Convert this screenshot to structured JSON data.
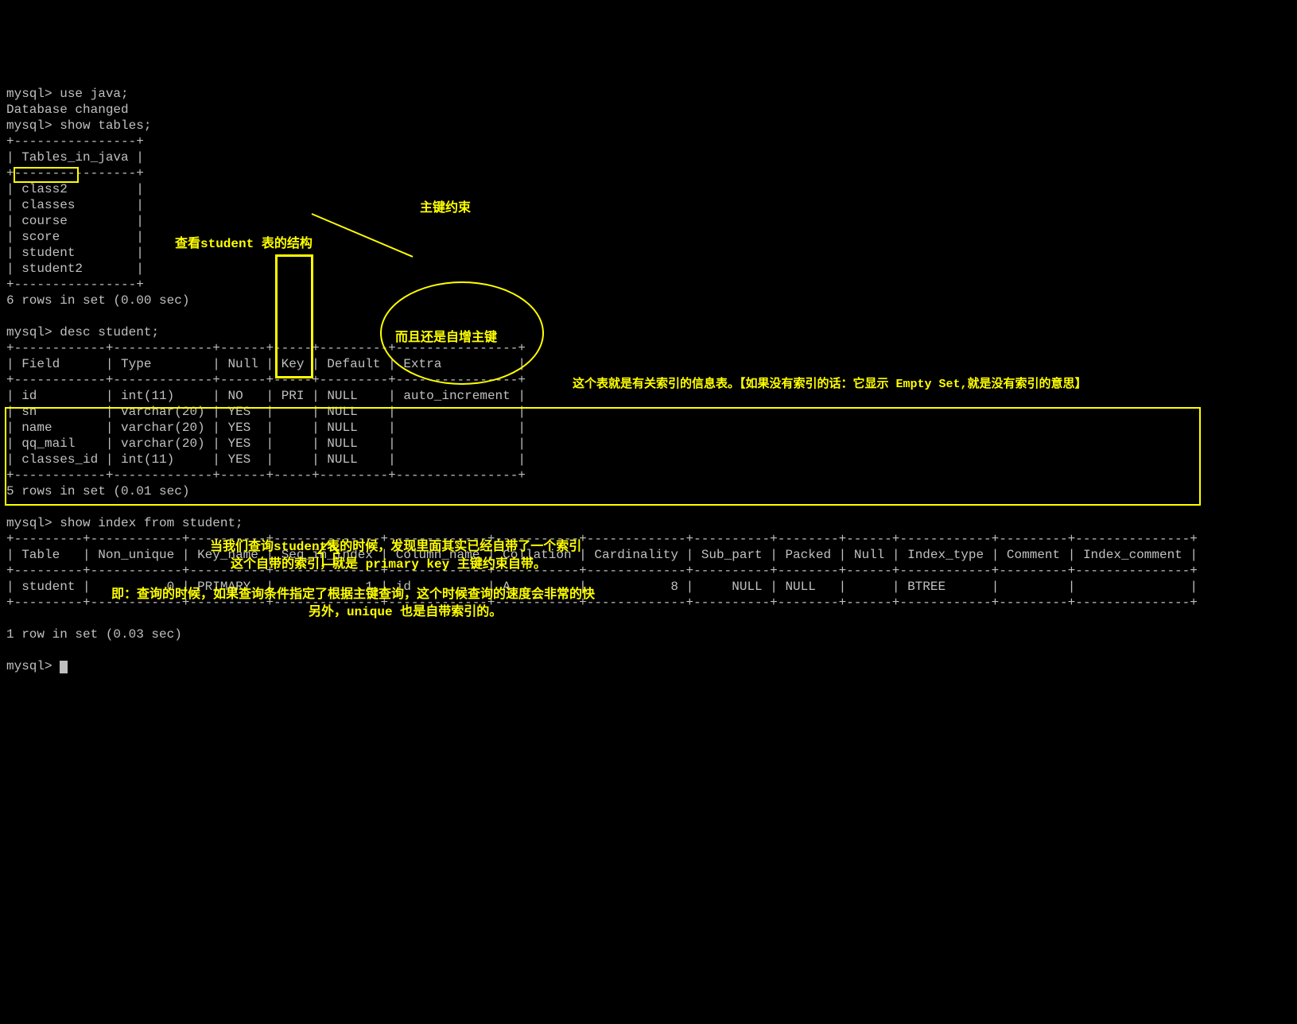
{
  "prompt": "mysql>",
  "cmd_use": "use java;",
  "resp_db_changed": "Database changed",
  "cmd_show_tables": "show tables;",
  "tables_header": "Tables_in_java",
  "tables": [
    "class2",
    "classes",
    "course",
    "score",
    "student",
    "student2"
  ],
  "tables_footer": "6 rows in set (0.00 sec)",
  "cmd_desc": "desc student;",
  "desc_headers": [
    "Field",
    "Type",
    "Null",
    "Key",
    "Default",
    "Extra"
  ],
  "desc_rows": [
    {
      "field": "id",
      "type": "int(11)",
      "null": "NO",
      "key": "PRI",
      "default": "NULL",
      "extra": "auto_increment"
    },
    {
      "field": "sn",
      "type": "varchar(20)",
      "null": "YES",
      "key": "",
      "default": "NULL",
      "extra": ""
    },
    {
      "field": "name",
      "type": "varchar(20)",
      "null": "YES",
      "key": "",
      "default": "NULL",
      "extra": ""
    },
    {
      "field": "qq_mail",
      "type": "varchar(20)",
      "null": "YES",
      "key": "",
      "default": "NULL",
      "extra": ""
    },
    {
      "field": "classes_id",
      "type": "int(11)",
      "null": "YES",
      "key": "",
      "default": "NULL",
      "extra": ""
    }
  ],
  "desc_footer": "5 rows in set (0.01 sec)",
  "cmd_show_index": "show index from student;",
  "index_headers": [
    "Table",
    "Non_unique",
    "Key_name",
    "Seq_in_index",
    "Column_name",
    "Collation",
    "Cardinality",
    "Sub_part",
    "Packed",
    "Null",
    "Index_type",
    "Comment",
    "Index_comment"
  ],
  "index_rows": [
    {
      "table": "student",
      "non_unique": "0",
      "key_name": "PRIMARY",
      "seq": "1",
      "col": "id",
      "coll": "A",
      "card": "8",
      "sub": "NULL",
      "packed": "NULL",
      "null": "",
      "itype": "BTREE",
      "comment": "",
      "icomment": ""
    }
  ],
  "index_footer": "1 row in set (0.03 sec)",
  "annotations": {
    "desc_label": "查看student 表的结构",
    "pk_label": "主键约束",
    "autoinc_label": "而且还是自增主键",
    "index_info": "这个表就是有关索引的信息表。【如果没有索引的话：它显示 Empty Set,就是没有索引的意思】",
    "found_line1": "当我们查询student表的时候，发现里面其实已经自带了一个索引",
    "found_line2": "这个自带的索引，就是 primary key 主键约束自带。",
    "conclusion_line1": "即：查询的时候，如果查询条件指定了根据主键查询，这个时候查询的速度会非常的快",
    "conclusion_line2": "另外，unique 也是自带索引的。"
  }
}
